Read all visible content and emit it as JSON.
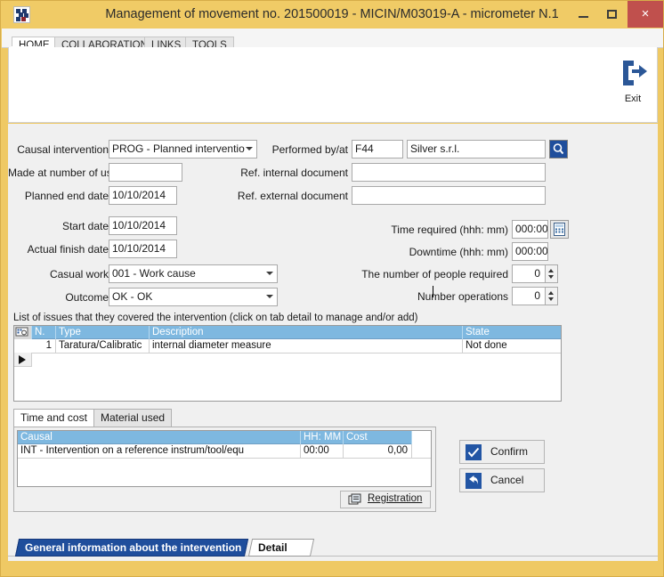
{
  "window": {
    "title": "Management of movement no. 201500019 - MICIN/M03019-A - micrometer N.1",
    "app_icon": "app-squares-icon",
    "minimize": "minimize-icon",
    "maximize": "maximize-icon",
    "close": "×",
    "titlebar_color": "#f0cb66",
    "close_color": "#c0504d"
  },
  "ribbon": {
    "tabs": [
      {
        "label": "HOME",
        "active": true
      },
      {
        "label": "COLLABORATION",
        "active": false
      },
      {
        "label": "LINKS",
        "active": false
      },
      {
        "label": "TOOLS",
        "active": false
      }
    ],
    "exit": {
      "label": "Exit",
      "icon": "exit-arrow-icon"
    }
  },
  "form": {
    "causal_intervention": {
      "label": "Causal intervention",
      "value": "PROG - Planned interventio"
    },
    "made_at_number": {
      "label": "Made at number of us",
      "value": ""
    },
    "planned_end_date": {
      "label": "Planned end date",
      "value": "10/10/2014"
    },
    "start_date": {
      "label": "Start date",
      "value": "10/10/2014"
    },
    "actual_finish_date": {
      "label": "Actual finish date",
      "value": "10/10/2014"
    },
    "casual_work": {
      "label": "Casual work",
      "value": "001 - Work cause"
    },
    "outcome": {
      "label": "Outcome",
      "value": "OK - OK"
    },
    "performed_by": {
      "label": "Performed by/at",
      "code": "F44",
      "name": "Silver s.r.l.",
      "search_icon": "search-icon"
    },
    "ref_internal_document": {
      "label": "Ref. internal document",
      "value": ""
    },
    "ref_external_document": {
      "label": "Ref. external document",
      "value": ""
    },
    "time_required": {
      "label": "Time required (hhh: mm)",
      "value": "000:00",
      "icon": "calculator-icon"
    },
    "downtime": {
      "label": "Downtime (hhh: mm)",
      "value": "000:00"
    },
    "people_required": {
      "label": "The number of people required",
      "value": "0"
    },
    "number_operations": {
      "label": "Number operations",
      "value": "0"
    }
  },
  "issues_grid": {
    "note": "List of issues that they covered the intervention (click on tab detail to manage and/or add)",
    "header_icon": "grid-settings-icon",
    "columns": [
      "N.",
      "Type",
      "Description",
      "State"
    ],
    "rows": [
      {
        "selector": "row-selector-arrow",
        "n": "1",
        "type": "Taratura/Calibratic",
        "description": "internal diameter measure",
        "state": "Not done"
      }
    ]
  },
  "lower_tabs": [
    {
      "label": "Time and cost",
      "active": true
    },
    {
      "label": "Material used",
      "active": false
    }
  ],
  "cost_grid": {
    "columns": [
      "Causal",
      "HH: MM",
      "Cost"
    ],
    "rows": [
      {
        "causal": "INT - Intervention on a reference instrum/tool/equ",
        "hhmm": "00:00",
        "cost": "0,00"
      }
    ],
    "registration_button": {
      "label": "Registration",
      "icon": "registration-icon"
    }
  },
  "actions": {
    "confirm": {
      "label": "Confirm",
      "icon": "check-icon"
    },
    "cancel": {
      "label": "Cancel",
      "icon": "back-arrow-icon"
    }
  },
  "page_tabs": [
    {
      "label": "General information about the intervention",
      "active": true
    },
    {
      "label": "Detail",
      "active": false
    }
  ]
}
